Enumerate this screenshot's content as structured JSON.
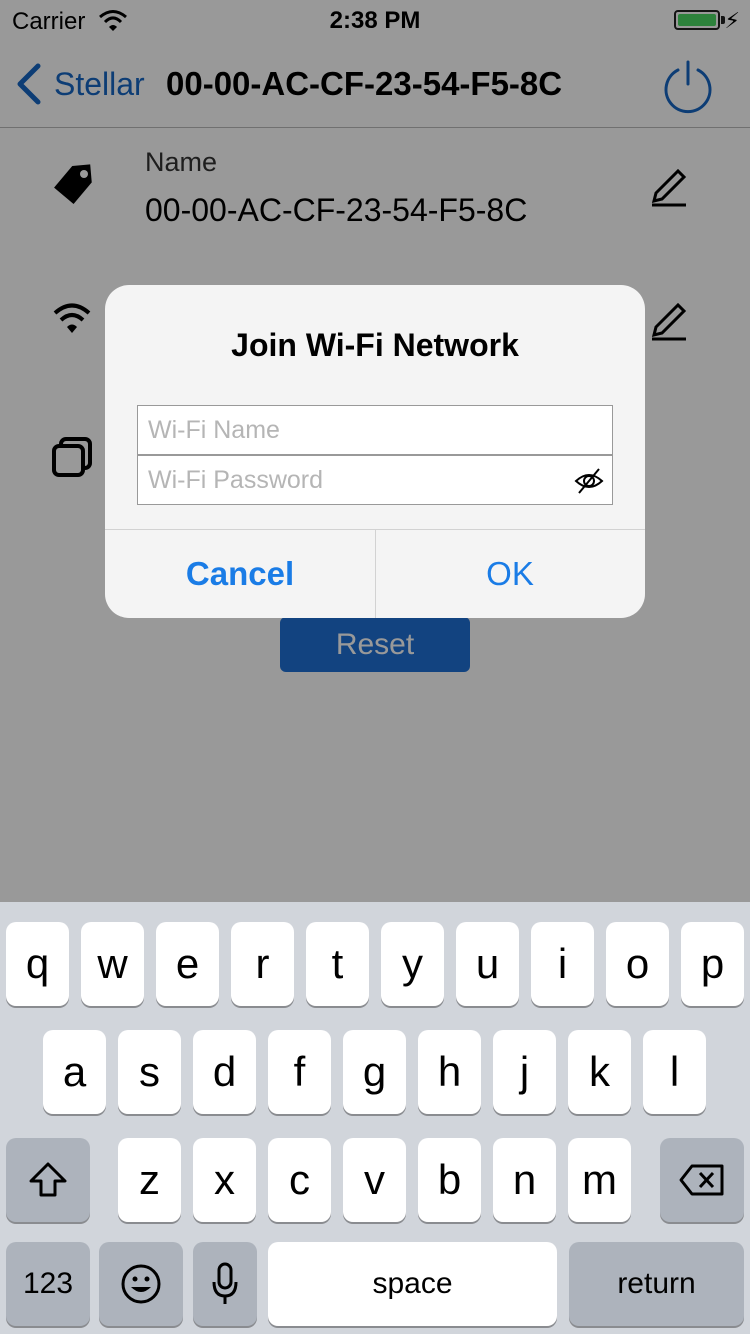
{
  "status_bar": {
    "carrier": "Carrier",
    "time": "2:38 PM"
  },
  "nav": {
    "back_label": "Stellar",
    "title": "00-00-AC-CF-23-54-F5-8C"
  },
  "device": {
    "name_label": "Name",
    "name_value": "00-00-AC-CF-23-54-F5-8C"
  },
  "reset_label": "Reset",
  "alert": {
    "title": "Join Wi-Fi Network",
    "wifi_name_placeholder": "Wi-Fi Name",
    "wifi_password_placeholder": "Wi-Fi Password",
    "cancel_label": "Cancel",
    "ok_label": "OK"
  },
  "keyboard": {
    "row1": [
      "q",
      "w",
      "e",
      "r",
      "t",
      "y",
      "u",
      "i",
      "o",
      "p"
    ],
    "row2": [
      "a",
      "s",
      "d",
      "f",
      "g",
      "h",
      "j",
      "k",
      "l"
    ],
    "row3": [
      "z",
      "x",
      "c",
      "v",
      "b",
      "n",
      "m"
    ],
    "numbers_label": "123",
    "space_label": "space",
    "return_label": "return"
  },
  "colors": {
    "accent": "#1766c4",
    "reset_button": "#1f70d6",
    "battery": "#4cd964",
    "alert_button": "#1a7ce6"
  }
}
